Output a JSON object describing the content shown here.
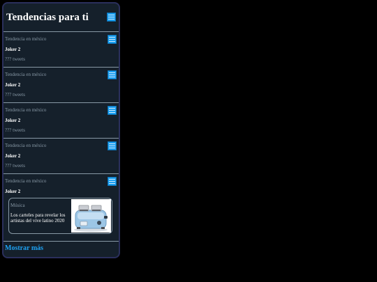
{
  "header": {
    "title": "Tendencias para ti"
  },
  "trends": [
    {
      "context": "Tendencia en méxico",
      "name": "Joker 2",
      "count": "??? tweets"
    },
    {
      "context": "Tendencia en méxico",
      "name": "Joker 2",
      "count": "??? tweets"
    },
    {
      "context": "Tendencia en méxico",
      "name": "Joker 2",
      "count": "??? tweets"
    },
    {
      "context": "Tendencia en méxico",
      "name": "Joker 2",
      "count": "??? tweets"
    },
    {
      "context": "Tendencia en méxico",
      "name": "Joker 2"
    }
  ],
  "card": {
    "category": "Música",
    "text": "Los carteles para revelar los artistas del vive latino 2020",
    "image_icon": "toaster-icon"
  },
  "footer": {
    "show_more": "Mostrar más"
  },
  "colors": {
    "background": "#15202b",
    "accent": "#1da1f2",
    "muted": "#8899a6"
  }
}
